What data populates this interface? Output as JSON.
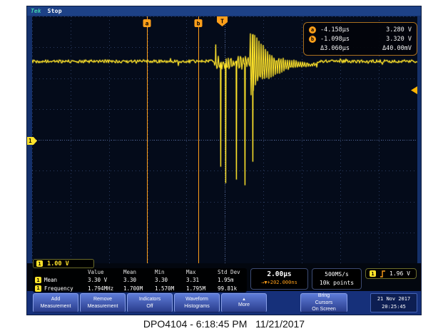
{
  "page": {
    "caption": "DPO4104 - 6:18:45 PM   11/21/2017"
  },
  "topbar": {
    "logo": "Tek",
    "status": "Stop",
    "trigger_flag": "T"
  },
  "cursors": {
    "a_label": "a",
    "b_label": "b"
  },
  "cursor_readout": {
    "rows": [
      {
        "badge": "a",
        "time": "-4.158μs",
        "voltage": "3.280 V"
      },
      {
        "badge": "b",
        "time": "-1.098μs",
        "voltage": "3.320 V"
      }
    ],
    "delta_time": "Δ3.060μs",
    "delta_voltage": "Δ40.00mV"
  },
  "channel": {
    "number": "1",
    "scale": "1.00 V"
  },
  "measurements": {
    "headers": [
      "Value",
      "Mean",
      "Min",
      "Max",
      "Std Dev"
    ],
    "rows": [
      {
        "ch": "1",
        "name": "Mean",
        "value": "3.30 V",
        "mean": "3.30",
        "min": "3.30",
        "max": "3.31",
        "stddev": "1.95m"
      },
      {
        "ch": "1",
        "name": "Frequency",
        "value": "1.794MHz",
        "mean": "1.700M",
        "min": "1.570M",
        "max": "1.795M",
        "stddev": "99.81k"
      }
    ]
  },
  "horizontal": {
    "timebase": "2.00μs",
    "delay_icon": "→▼",
    "delay": "+202.000ns"
  },
  "acquisition": {
    "sample_rate": "500MS/s",
    "record_length": "10k points"
  },
  "trigger": {
    "ch": "1",
    "level": "1.96 V"
  },
  "menu": [
    {
      "line1": "Add",
      "line2": "Measurement"
    },
    {
      "line1": "Remove",
      "line2": "Measurement"
    },
    {
      "line1": "Indicators",
      "line2": "Off"
    },
    {
      "line1": "Waveform",
      "line2": "Histograms"
    },
    {
      "line1": "▲",
      "line2": "More"
    }
  ],
  "cursor_button": {
    "line1": "Bring",
    "line2": "Cursors",
    "line3": "On Screen"
  },
  "datetime": {
    "date": "21 Nov 2017",
    "time": "20:25:45"
  },
  "colors": {
    "trace": "#ffe32a",
    "cursor": "#ff9f1a",
    "grid": "#2c3d63",
    "grid_center": "#51648f"
  },
  "waveform": {
    "color": "#ffe32a",
    "flat_level": 63,
    "noise": 2.0,
    "burst_start": 256,
    "ring_center": 306,
    "ring_end": 400,
    "ring_amp": 52,
    "ring_decay": 27,
    "spikes": [
      [
        257,
        40
      ],
      [
        264,
        210
      ],
      [
        271,
        233
      ],
      [
        286,
        228
      ],
      [
        298,
        236
      ],
      [
        309,
        203
      ]
    ]
  }
}
